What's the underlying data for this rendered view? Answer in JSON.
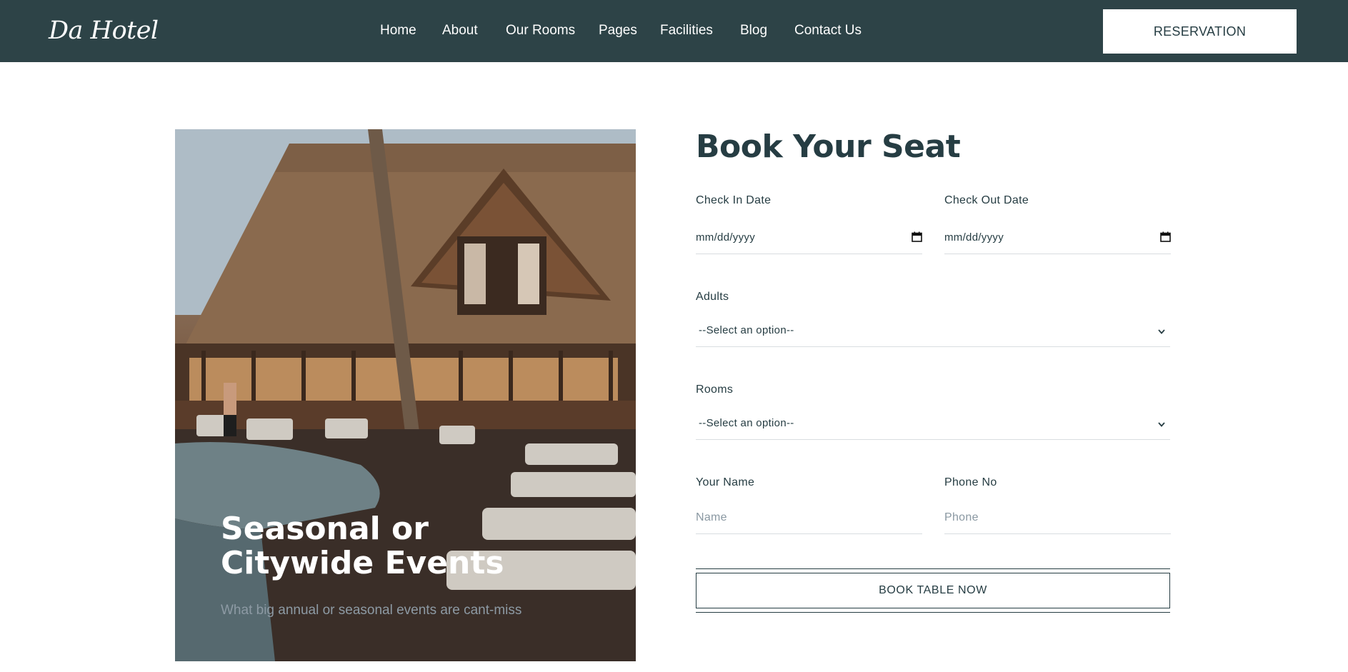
{
  "brand": {
    "logo_text": "Da Hotel"
  },
  "nav": {
    "items": [
      {
        "label": "Home"
      },
      {
        "label": "About"
      },
      {
        "label": "Our Rooms"
      },
      {
        "label": "Pages"
      },
      {
        "label": "Facilities"
      },
      {
        "label": "Blog"
      },
      {
        "label": "Contact Us"
      }
    ],
    "cta_label": "RESERVATION"
  },
  "promo": {
    "title": "Seasonal or Citywide Events",
    "subtitle": "What big annual or seasonal events are cant-miss"
  },
  "booking": {
    "title": "Book Your Seat",
    "check_in": {
      "label": "Check In Date",
      "value": "mm/dd/yyyy"
    },
    "check_out": {
      "label": "Check Out Date",
      "value": "mm/dd/yyyy"
    },
    "adults": {
      "label": "Adults",
      "value": "--Select an option--"
    },
    "rooms": {
      "label": "Rooms",
      "value": "--Select an option--"
    },
    "name": {
      "label": "Your Name",
      "placeholder": "Name"
    },
    "phone": {
      "label": "Phone No",
      "placeholder": "Phone"
    },
    "submit_label": "BOOK TABLE NOW"
  },
  "colors": {
    "header_bg": "#2d4347",
    "text_dark": "#263d43",
    "placeholder": "#8a98a2"
  }
}
